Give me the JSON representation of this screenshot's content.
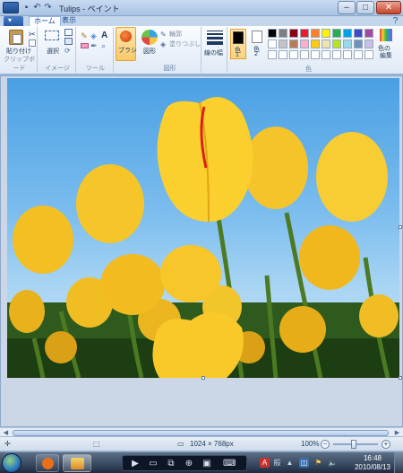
{
  "window": {
    "title": "Tulips - ペイント",
    "minimize_icon": "minimize-icon",
    "maximize_icon": "maximize-icon",
    "close_icon": "close-icon"
  },
  "tabs": [
    {
      "label": "ホーム",
      "active": true
    },
    {
      "label": "表示",
      "active": false
    }
  ],
  "ribbon": {
    "clipboard": {
      "paste_label": "貼り付け",
      "group_label": "クリップボード"
    },
    "image": {
      "select_label": "選択",
      "group_label": "イメージ"
    },
    "tools": {
      "group_label": "ツール"
    },
    "brush": {
      "label": "ブラシ"
    },
    "shapes": {
      "shapes_label": "図形",
      "outline_label": "輪郭",
      "fill_label": "塗りつぶし",
      "group_label": "図形"
    },
    "size": {
      "label": "線の幅"
    },
    "colors": {
      "color1_label": "色\n1",
      "color1_line1": "色",
      "color1_line2": "1",
      "color2_line1": "色",
      "color2_line2": "2",
      "edit_label": "色の\n編集",
      "edit_line1": "色の",
      "edit_line2": "編集",
      "group_label": "色",
      "palette_row1": [
        "#000000",
        "#7f7f7f",
        "#880015",
        "#ed1c24",
        "#ff7f27",
        "#fff200",
        "#22b14c",
        "#00a2e8",
        "#3f48cc",
        "#a349a4"
      ],
      "palette_row2": [
        "#ffffff",
        "#c3c3c3",
        "#b97a57",
        "#ffaec9",
        "#ffc90e",
        "#efe4b0",
        "#b5e61d",
        "#99d9ea",
        "#7092be",
        "#c8bfe7"
      ]
    }
  },
  "status": {
    "dimensions": "1024 × 768px",
    "zoom": "100%"
  },
  "taskbar": {
    "time": "16:48",
    "date": "2010/08/13"
  }
}
